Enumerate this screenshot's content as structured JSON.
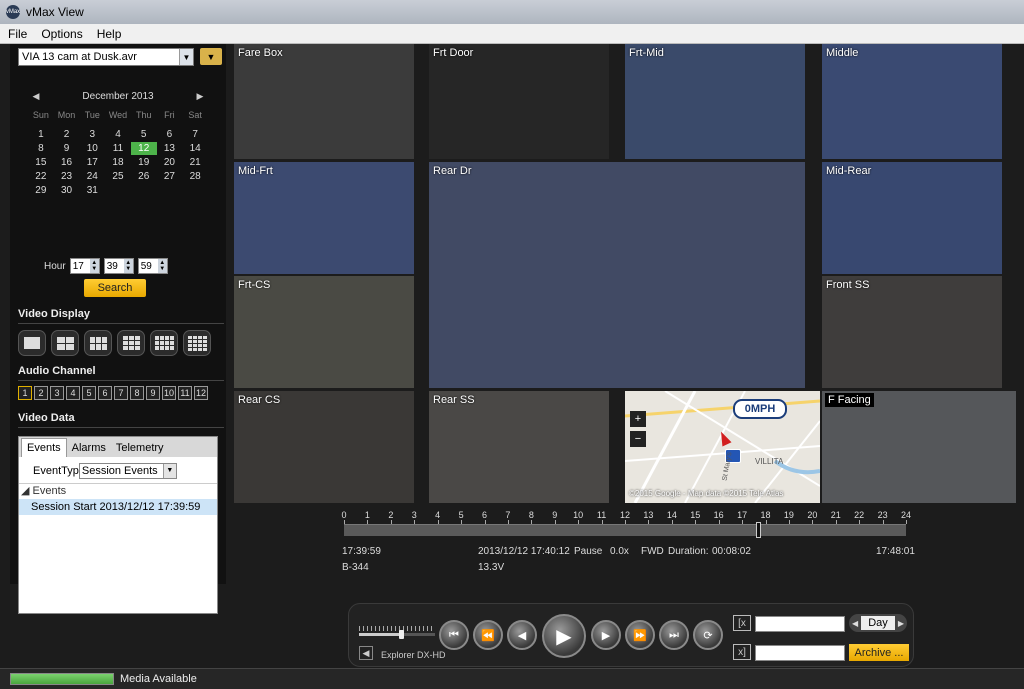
{
  "window": {
    "title": "vMax View",
    "icon_text": "vMax"
  },
  "menu": [
    "File",
    "Options",
    "Help"
  ],
  "file_select": {
    "value": "VIA 13 cam at Dusk.avr",
    "folder_icon": "folder-icon"
  },
  "calendar": {
    "month": "December 2013",
    "prev": "◀",
    "next": "▶",
    "weekdays": [
      "Sun",
      "Mon",
      "Tue",
      "Wed",
      "Thu",
      "Fri",
      "Sat"
    ],
    "weeks": [
      [
        "1",
        "2",
        "3",
        "4",
        "5",
        "6",
        "7"
      ],
      [
        "8",
        "9",
        "10",
        "11",
        "12",
        "13",
        "14"
      ],
      [
        "15",
        "16",
        "17",
        "18",
        "19",
        "20",
        "21"
      ],
      [
        "22",
        "23",
        "24",
        "25",
        "26",
        "27",
        "28"
      ],
      [
        "29",
        "30",
        "31",
        "",
        "",
        "",
        ""
      ]
    ],
    "selected_day": "12",
    "highlight_color": "#4db34a"
  },
  "time": {
    "label": "Hour",
    "hour": "17",
    "minute": "39",
    "second": "59"
  },
  "search_button": "Search",
  "video_display": {
    "title": "Video Display",
    "layouts": [
      [
        1,
        1
      ],
      [
        2,
        2
      ],
      [
        3,
        2
      ],
      [
        3,
        3
      ],
      [
        4,
        3
      ],
      [
        4,
        4
      ]
    ]
  },
  "audio_channel": {
    "title": "Audio Channel",
    "channels": [
      "1",
      "2",
      "3",
      "4",
      "5",
      "6",
      "7",
      "8",
      "9",
      "10",
      "11",
      "12"
    ],
    "active": "1"
  },
  "video_data": {
    "title": "Video Data",
    "tabs": [
      "Events",
      "Alarms",
      "Telemetry"
    ],
    "active_tab": "Events",
    "event_type_label": "EventTyp",
    "event_type_value": "Session Events",
    "tree_root": "Events",
    "tree_item": "Session Start 2013/12/12 17:39:59"
  },
  "cameras": {
    "fare_box": "Fare Box",
    "frt_door": "Frt Door",
    "frt_mid": "Frt-Mid",
    "middle": "Middle",
    "mid_frt": "Mid-Frt",
    "rear_dr": "Rear Dr",
    "mid_rear": "Mid-Rear",
    "frt_cs": "Frt-CS",
    "front_ss": "Front SS",
    "rear_cs": "Rear CS",
    "rear_ss": "Rear SS",
    "f_facing": "F Facing"
  },
  "map": {
    "speed": "0MPH",
    "copyright": "©2015 Google - Map data ©2015 Tele Atlas",
    "place": "VILLITA",
    "street": "St Mary's",
    "zoom_in": "+",
    "zoom_out": "−"
  },
  "timeline": {
    "hours": [
      "0",
      "1",
      "2",
      "3",
      "4",
      "5",
      "6",
      "7",
      "8",
      "9",
      "10",
      "11",
      "12",
      "13",
      "14",
      "15",
      "16",
      "17",
      "18",
      "19",
      "20",
      "21",
      "22",
      "23",
      "24"
    ],
    "position_hour": 17.66
  },
  "playback_info": {
    "start_time": "17:39:59",
    "current": "2013/12/12 17:40:12",
    "state": "Pause",
    "speed": "0.0x",
    "direction": "FWD",
    "duration_label": "Duration:",
    "duration": "00:08:02",
    "end_time": "17:48:01",
    "bus_id": "B-344",
    "voltage": "13.3V"
  },
  "controls": {
    "volume_level": 0.55,
    "mute_icon": "speaker-icon",
    "device": "Explorer DX-HD",
    "buttons": [
      "⏮",
      "⏪",
      "◀",
      "▶",
      "▶",
      "⏩",
      "⏭",
      "⟳"
    ],
    "day_label": "Day",
    "archive_label": "Archive ..."
  },
  "status": {
    "text": "Media Available"
  }
}
